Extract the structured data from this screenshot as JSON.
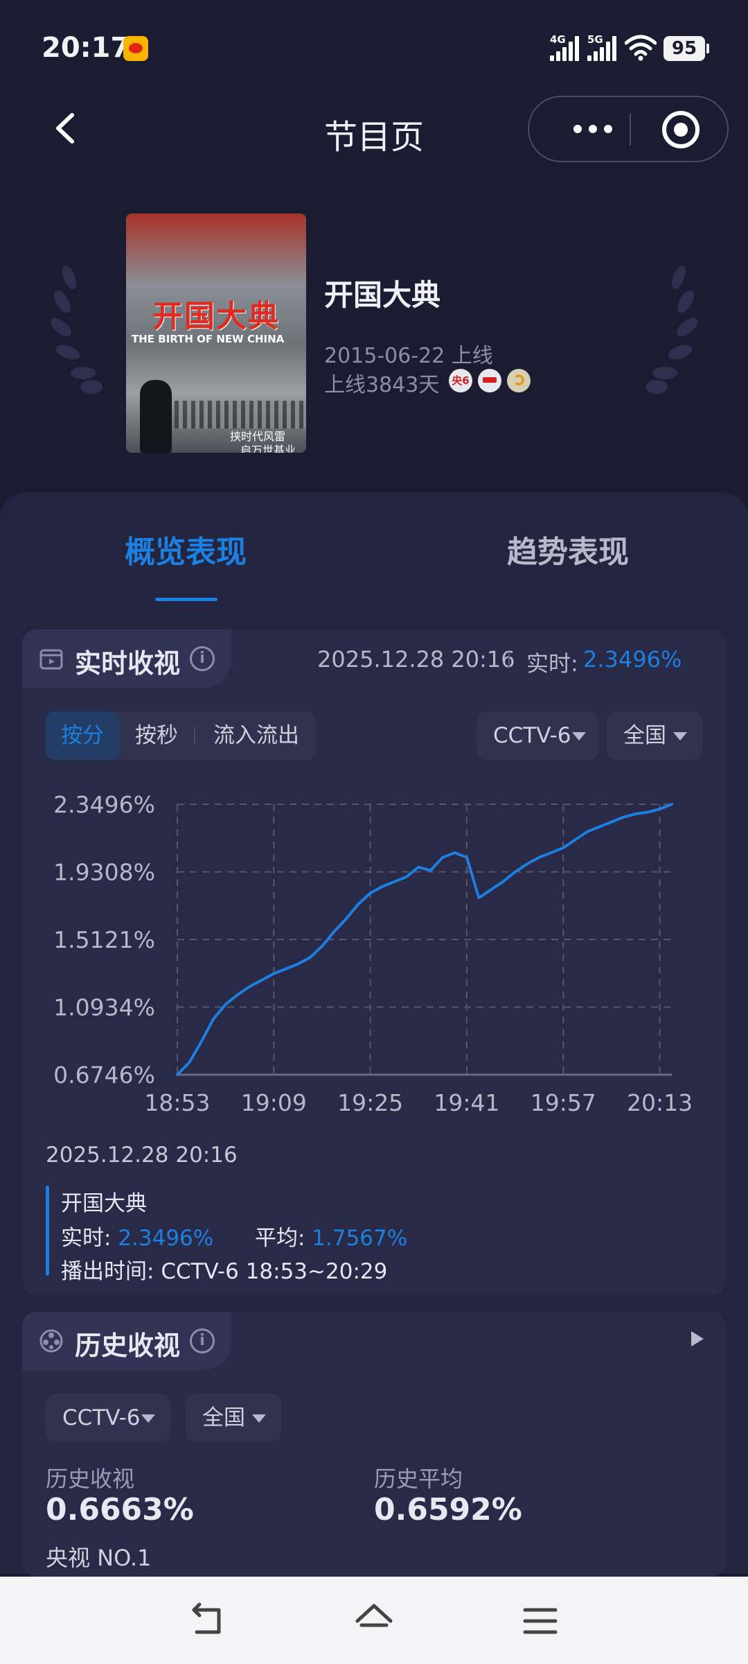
{
  "status_bar": {
    "time": "20:17",
    "net_1": "4G",
    "net_2": "5G",
    "battery": "95"
  },
  "nav": {
    "title": "节目页"
  },
  "program": {
    "title": "开国大典",
    "online_date": "2015-06-22 上线",
    "online_days": "上线3843天",
    "poster": {
      "title": "开国大典",
      "subtitle": "THE BIRTH OF NEW CHINA",
      "tagline_1": "挟时代风雷",
      "tagline_2": "启万世基业"
    },
    "badges": [
      "央6",
      "",
      ""
    ]
  },
  "tabs": {
    "overview": "概览表现",
    "trend": "趋势表现"
  },
  "realtime": {
    "title": "实时收视",
    "info": "i",
    "timestamp": "2025.12.28 20:16",
    "live_label": "实时:",
    "live_value": "2.3496%",
    "segments": [
      "按分",
      "按秒",
      "流入流出"
    ],
    "channel": "CCTV-6",
    "region": "全国"
  },
  "chart_data": {
    "type": "line",
    "x": [
      "18:53",
      "18:55",
      "18:57",
      "18:59",
      "19:01",
      "19:03",
      "19:05",
      "19:07",
      "19:09",
      "19:11",
      "19:13",
      "19:15",
      "19:17",
      "19:19",
      "19:21",
      "19:23",
      "19:25",
      "19:27",
      "19:29",
      "19:31",
      "19:33",
      "19:35",
      "19:37",
      "19:39",
      "19:41",
      "19:43",
      "19:45",
      "19:47",
      "19:49",
      "19:51",
      "19:53",
      "19:55",
      "19:57",
      "19:59",
      "20:01",
      "20:03",
      "20:05",
      "20:07",
      "20:09",
      "20:11",
      "20:13",
      "20:15"
    ],
    "series": [
      {
        "values": [
          0.6746,
          0.75,
          0.88,
          1.02,
          1.11,
          1.17,
          1.22,
          1.26,
          1.3,
          1.33,
          1.36,
          1.4,
          1.47,
          1.56,
          1.64,
          1.73,
          1.8,
          1.84,
          1.87,
          1.9,
          1.96,
          1.94,
          2.02,
          2.05,
          2.02,
          1.77,
          1.82,
          1.87,
          1.93,
          1.98,
          2.02,
          2.05,
          2.08,
          2.13,
          2.18,
          2.21,
          2.24,
          2.27,
          2.29,
          2.3,
          2.32,
          2.3496
        ],
        "color": "#1d7fe0"
      }
    ],
    "y_ticks": [
      "0.6746%",
      "1.0934%",
      "1.5121%",
      "1.9308%",
      "2.3496%"
    ],
    "x_ticks": [
      "18:53",
      "19:09",
      "19:25",
      "19:41",
      "19:57",
      "20:13"
    ],
    "ylim": [
      0.6746,
      2.3496
    ],
    "grid": true
  },
  "detail": {
    "timestamp": "2025.12.28 20:16",
    "name": "开国大典",
    "live_label": "实时:",
    "live_value": "2.3496%",
    "avg_label": "平均:",
    "avg_value": "1.7567%",
    "air_label": "播出时间:",
    "air_value": "CCTV-6 18:53~20:29"
  },
  "history": {
    "title": "历史收视",
    "info": "i",
    "channel": "CCTV-6",
    "region": "全国",
    "rating_label": "历史收视",
    "rating_value": "0.6663%",
    "avg_label": "历史平均",
    "avg_value": "0.6592%",
    "rank": "央视 NO.1"
  },
  "colors": {
    "accent": "#1d7fe0",
    "background": "#1b1c32",
    "card": "#222440"
  }
}
